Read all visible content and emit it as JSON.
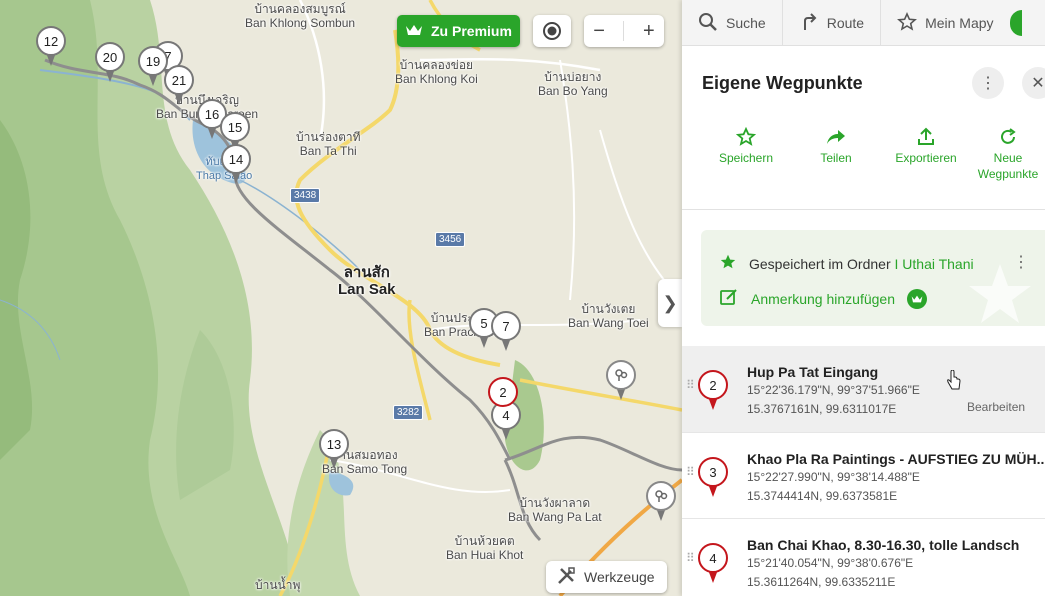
{
  "map": {
    "places": [
      {
        "id": "ban-khlong-sombun",
        "thai": "บ้านคลองสมบูรณ์",
        "latin": "Ban Khlong Sombun"
      },
      {
        "id": "ban-khlong-koi",
        "thai": "บ้านคลองข่อย",
        "latin": "Ban Khlong Koi"
      },
      {
        "id": "ban-bo-yang",
        "thai": "บ้านบ่อยาง",
        "latin": "Ban Bo Yang"
      },
      {
        "id": "ban-ta-thi",
        "thai": "บ้านร่องตาที",
        "latin": "Ban Ta Thi"
      },
      {
        "id": "ban-bung-charoen",
        "thai": "บ้านบึงเจริญ",
        "latin": "Ban Bung Charoen"
      },
      {
        "id": "thap-salao",
        "thai": "ทับเสลา",
        "latin": "Thap Salao"
      },
      {
        "id": "lan-sak",
        "thai": "ลานสัก",
        "latin": "Lan Sak"
      },
      {
        "id": "ban-prachum",
        "thai": "บ้านประชุม",
        "latin": "Ban Prachum"
      },
      {
        "id": "ban-wang-toei",
        "thai": "บ้านวังเตย",
        "latin": "Ban Wang Toei"
      },
      {
        "id": "ban-samo-tong",
        "thai": "บ้านสมอทอง",
        "latin": "Ban Samo Tong"
      },
      {
        "id": "ban-wang-pa-lat",
        "thai": "บ้านวังผาลาด",
        "latin": "Ban Wang Pa Lat"
      },
      {
        "id": "ban-huai-khot",
        "thai": "บ้านห้วยคต",
        "latin": "Ban Huai Khot"
      },
      {
        "id": "ban-nam-phu",
        "thai": "บ้านน้ำพุ",
        "latin": ""
      }
    ],
    "road_numbers": [
      "3438",
      "3456",
      "3282"
    ],
    "pins": [
      "12",
      "20",
      "7",
      "19",
      "21",
      "16",
      "15",
      "14",
      "5",
      "7",
      "2",
      "4",
      "13"
    ],
    "premium_label": "Zu Premium",
    "zoom_out": "−",
    "zoom_in": "+",
    "tools_label": "Werkzeuge",
    "collapse_arrow": "❯"
  },
  "nav": {
    "search": "Suche",
    "route": "Route",
    "my_mapy": "Mein Mapy"
  },
  "panel": {
    "title": "Eigene Wegpunkte",
    "actions": [
      {
        "label": "Speichern",
        "icon": "star-outline-icon"
      },
      {
        "label": "Teilen",
        "icon": "share-arrow-icon"
      },
      {
        "label": "Exportieren",
        "icon": "export-icon"
      },
      {
        "label": "Neue Wegpunkte",
        "icon": "refresh-icon"
      }
    ],
    "folder": {
      "prefix": "Gespeichert im Ordner",
      "name": "I Uthai Thani",
      "note_label": "Anmerkung hinzufügen"
    },
    "waypoints": [
      {
        "num": "2",
        "name": "Hup Pa Tat Eingang",
        "dms": "15°22'36.179\"N, 99°37'51.966\"E",
        "dec": "15.3767161N, 99.6311017E",
        "edit": "Bearbeiten"
      },
      {
        "num": "3",
        "name": "Khao Pla Ra Paintings - AUFSTIEG ZU MÜH...",
        "dms": "15°22'27.990\"N, 99°38'14.488\"E",
        "dec": "15.3744414N, 99.6373581E"
      },
      {
        "num": "4",
        "name": "Ban Chai Khao, 8.30-16.30, tolle Landsch",
        "dms": "15°21'40.054\"N, 99°38'0.676\"E",
        "dec": "15.3611264N, 99.6335211E"
      }
    ]
  },
  "colors": {
    "accent_green": "#2aa52a",
    "pin_red": "#c4161c",
    "pin_grey": "#777777"
  }
}
